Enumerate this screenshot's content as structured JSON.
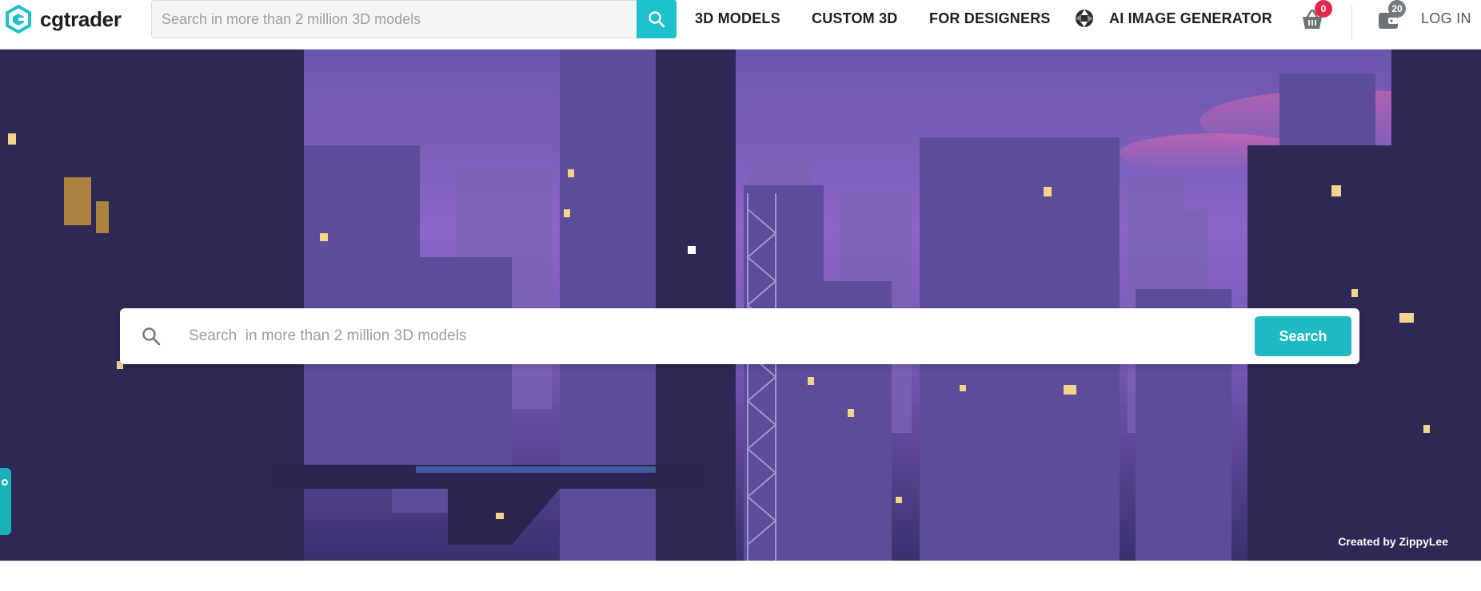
{
  "brand": {
    "name": "cgtrader",
    "accent": "#1ec0c9"
  },
  "header": {
    "search_placeholder": "Search in more than 2 million 3D models",
    "nav": [
      "3D MODELS",
      "CUSTOM 3D",
      "FOR DESIGNERS",
      "AI IMAGE GENERATOR"
    ],
    "cart_count": "0",
    "wallet_count": "20",
    "login_label": "LOG IN"
  },
  "hero": {
    "search_placeholder": "Search  in more than 2 million 3D models",
    "search_button": "Search",
    "credit": "Created by ZippyLee"
  },
  "icons": {
    "logo": "cgtrader-hex-logo-icon",
    "search": "search-icon",
    "ai": "aperture-icon",
    "cart": "basket-icon",
    "wallet": "wallet-icon",
    "feedback": "feedback-icon"
  }
}
